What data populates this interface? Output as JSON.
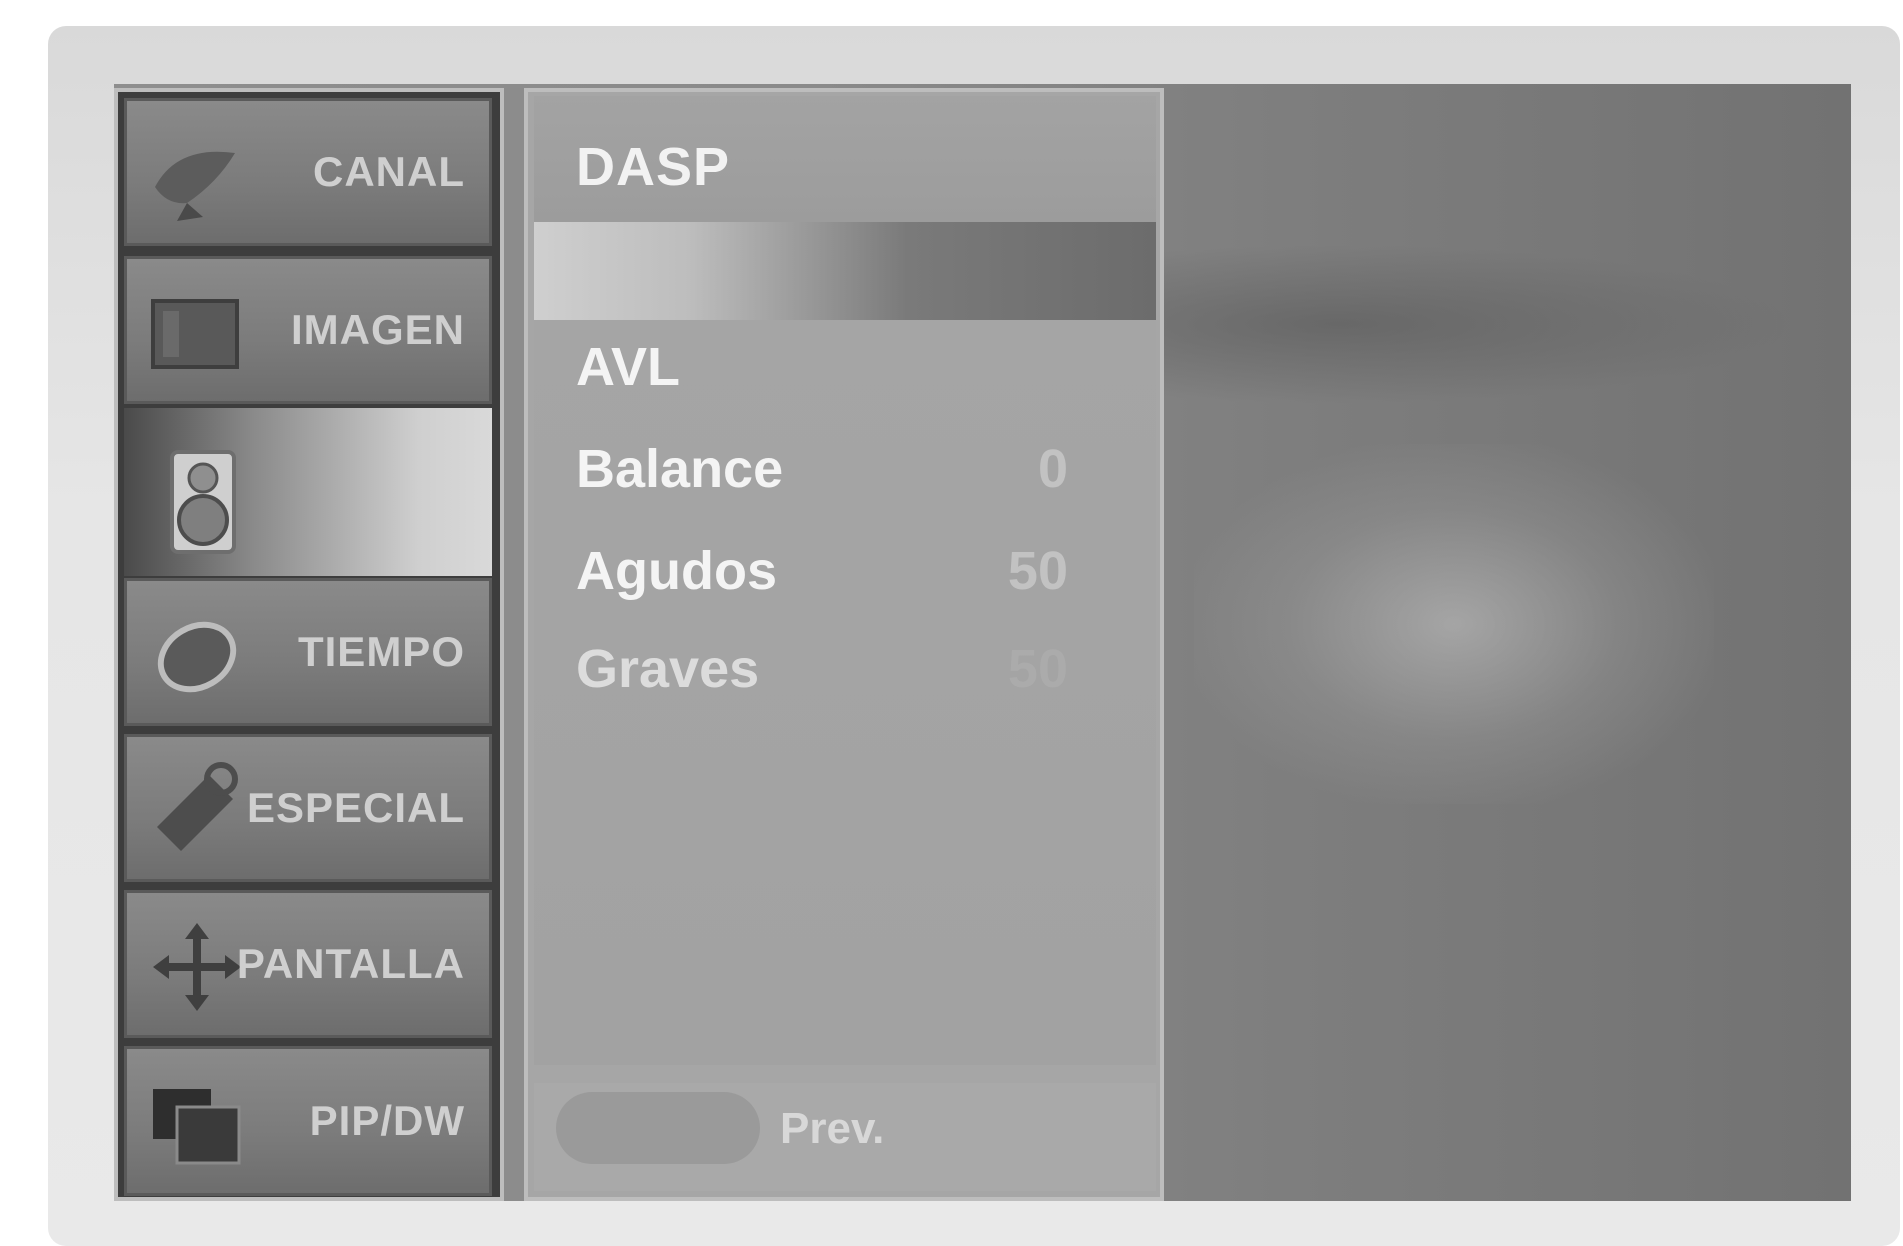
{
  "menu": {
    "tabs": [
      {
        "label": "CANAL",
        "icon": "satellite-dish-icon"
      },
      {
        "label": "IMAGEN",
        "icon": "picture-frame-icon"
      },
      {
        "label": "",
        "icon": "speaker-icon",
        "active": true
      },
      {
        "label": "TIEMPO",
        "icon": "clock-icon"
      },
      {
        "label": "ESPECIAL",
        "icon": "tag-icon"
      },
      {
        "label": "PANTALLA",
        "icon": "move-arrows-icon"
      },
      {
        "label": "PIP/DW",
        "icon": "pip-windows-icon"
      }
    ]
  },
  "panel": {
    "title": "DASP",
    "items": [
      {
        "label": "AVL",
        "value": ""
      },
      {
        "label": "Balance",
        "value": "0"
      },
      {
        "label": "Agudos",
        "value": "50"
      },
      {
        "label": "Graves",
        "value": "50"
      }
    ],
    "footer_label": "Prev."
  },
  "colors": {
    "screen_bg": "#8a8a8a",
    "panel_bg": "#a5a5a5",
    "text_bright": "#f4f4f4",
    "text_dim": "#c2c2c2"
  }
}
